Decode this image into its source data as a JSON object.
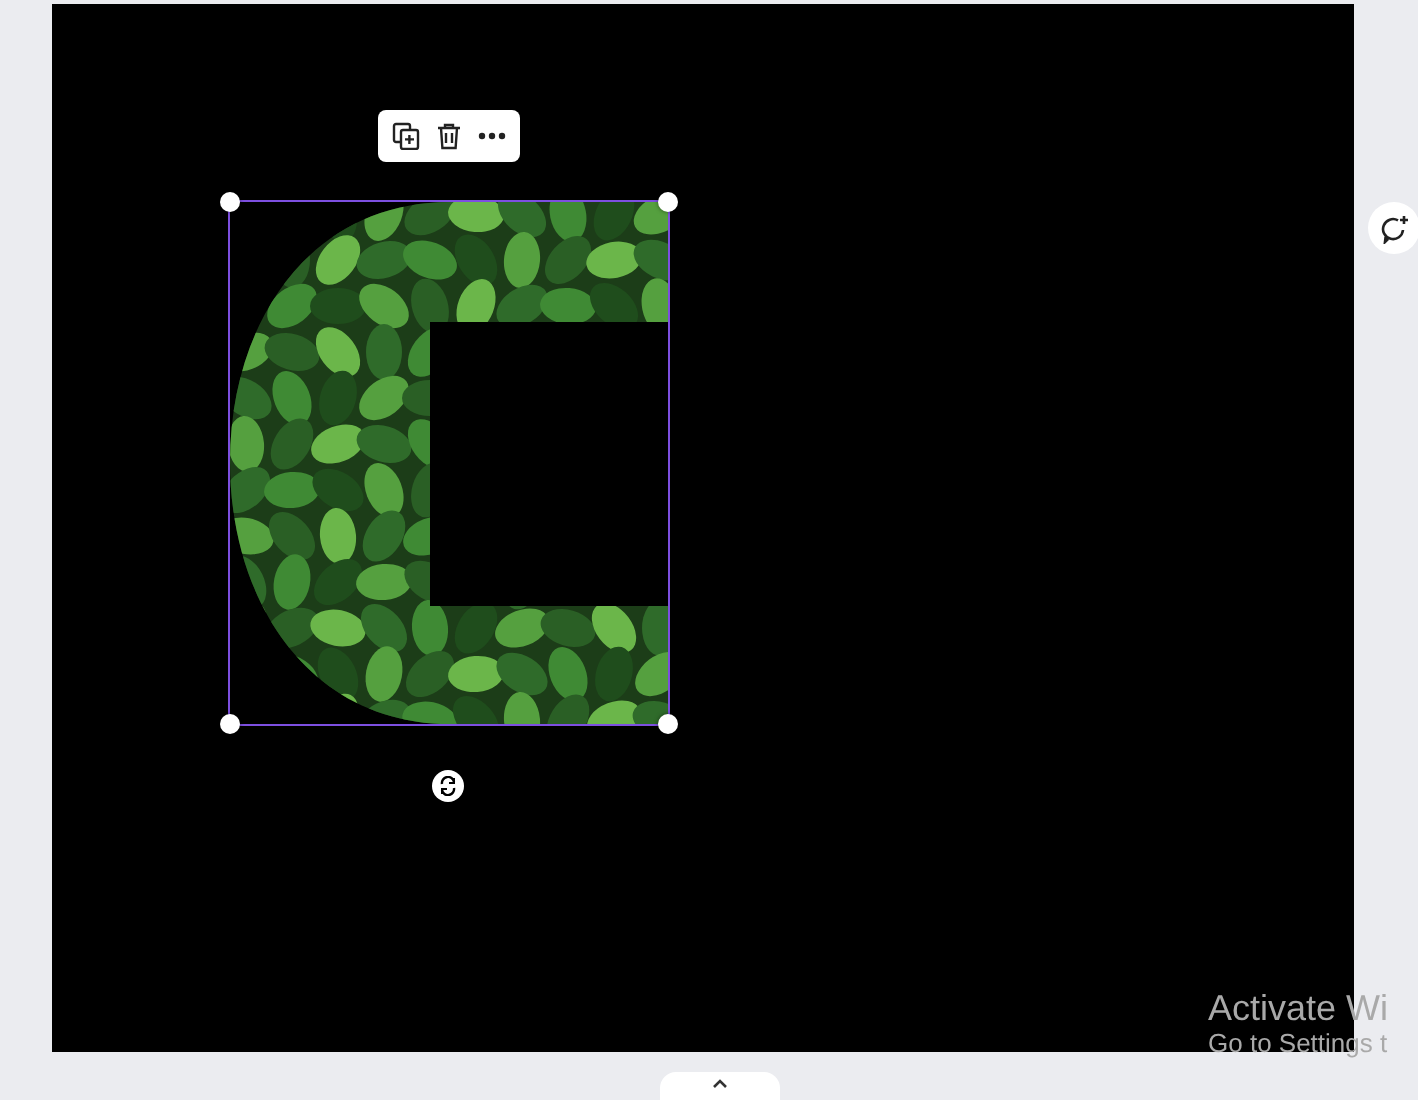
{
  "canvas": {
    "element": {
      "kind": "image",
      "selected": true
    }
  },
  "element_toolbar": {
    "buttons": [
      {
        "kind": "duplicate"
      },
      {
        "kind": "delete"
      },
      {
        "kind": "more"
      }
    ]
  },
  "side_buttons": [
    {
      "kind": "add-comment"
    }
  ],
  "activation_notice": {
    "title": "Activate Wi",
    "subtitle": "Go to Settings t"
  }
}
